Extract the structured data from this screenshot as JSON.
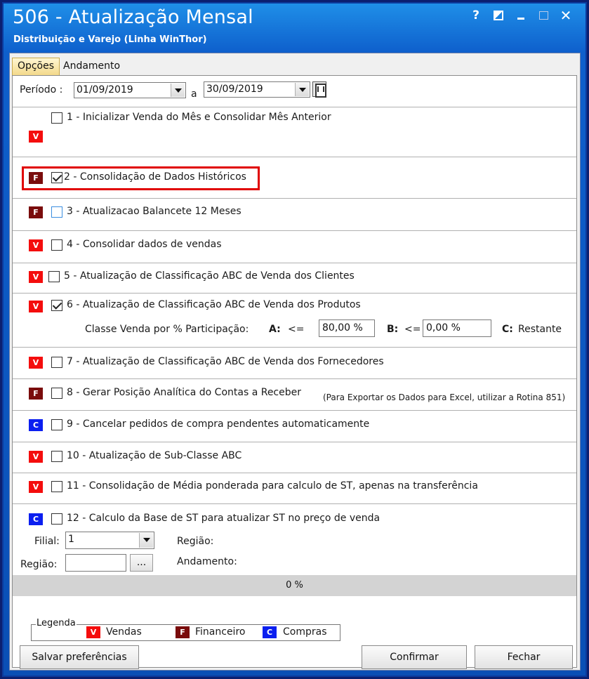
{
  "window": {
    "title": "506 - Atualização Mensal",
    "subtitle": "Distribuição e Varejo (Linha WinThor)",
    "controls": {
      "help": "?",
      "close": "✕"
    }
  },
  "tabs": [
    {
      "label": "Opções",
      "active": true
    },
    {
      "label": "Andamento",
      "active": false
    }
  ],
  "periodo": {
    "label": "Período :",
    "start": "01/09/2019",
    "connector": "a",
    "end": "30/09/2019"
  },
  "options": [
    {
      "badge": "V",
      "checked": false,
      "label": "1 - Inicializar Venda do Mês e Consolidar Mês Anterior"
    },
    {
      "badge": "F",
      "checked": true,
      "label": "2 - Consolidação de Dados Históricos"
    },
    {
      "badge": "F",
      "checked": false,
      "label": "3 - Atualizacao Balancete 12 Meses"
    },
    {
      "badge": "V",
      "checked": false,
      "label": "4 - Consolidar dados de vendas"
    },
    {
      "badge": "V",
      "checked": false,
      "label": "5 - Atualização de Classificação ABC de Venda dos Clientes"
    },
    {
      "badge": "V",
      "checked": true,
      "label": "6 - Atualização de Classificação ABC de Venda dos Produtos"
    },
    {
      "badge": "V",
      "checked": false,
      "label": "7 - Atualização de Classificação ABC de Venda dos Fornecedores"
    },
    {
      "badge": "F",
      "checked": false,
      "label": "8 - Gerar  Posição Analítica do Contas a Receber"
    },
    {
      "badge": "C",
      "checked": false,
      "label": "9 - Cancelar pedidos de compra pendentes automaticamente"
    },
    {
      "badge": "V",
      "checked": false,
      "label": "10 - Atualização de Sub-Classe ABC"
    },
    {
      "badge": "V",
      "checked": false,
      "label": "11 - Consolidação de Média ponderada para calculo de ST, apenas na transferência"
    },
    {
      "badge": "C",
      "checked": false,
      "label": "12 - Calculo da Base de ST para atualizar ST no preço de venda"
    }
  ],
  "option8_note": "(Para Exportar os Dados para Excel, utilizar a Rotina 851)",
  "abc": {
    "label": "Classe Venda por % Participação:",
    "a_label": "A:",
    "a_op": "<=",
    "a_value": "80,00 %",
    "b_label": "B:",
    "b_op": "<=",
    "b_value": "0,00 %",
    "c_label": "C:",
    "c_value": "Restante"
  },
  "filial": {
    "label": "Filial:",
    "value": "1"
  },
  "regiao": {
    "label": "Região:",
    "value": "",
    "button": "...",
    "right_label": "Região:"
  },
  "andamento_label": "Andamento:",
  "progress": {
    "text": "0 %",
    "value": 0
  },
  "legenda": {
    "title": "Legenda",
    "items": [
      {
        "badge": "V",
        "label": "Vendas"
      },
      {
        "badge": "F",
        "label": "Financeiro"
      },
      {
        "badge": "C",
        "label": "Compras"
      }
    ]
  },
  "buttons": {
    "salvar": "Salvar preferências",
    "confirmar": "Confirmar",
    "fechar": "Fechar"
  },
  "colors": {
    "vendas": "#f40d0d",
    "financeiro": "#7a0c0c",
    "compras": "#0b1ff0",
    "highlight": "#e00000",
    "title_bar": "#0e5fcc"
  }
}
